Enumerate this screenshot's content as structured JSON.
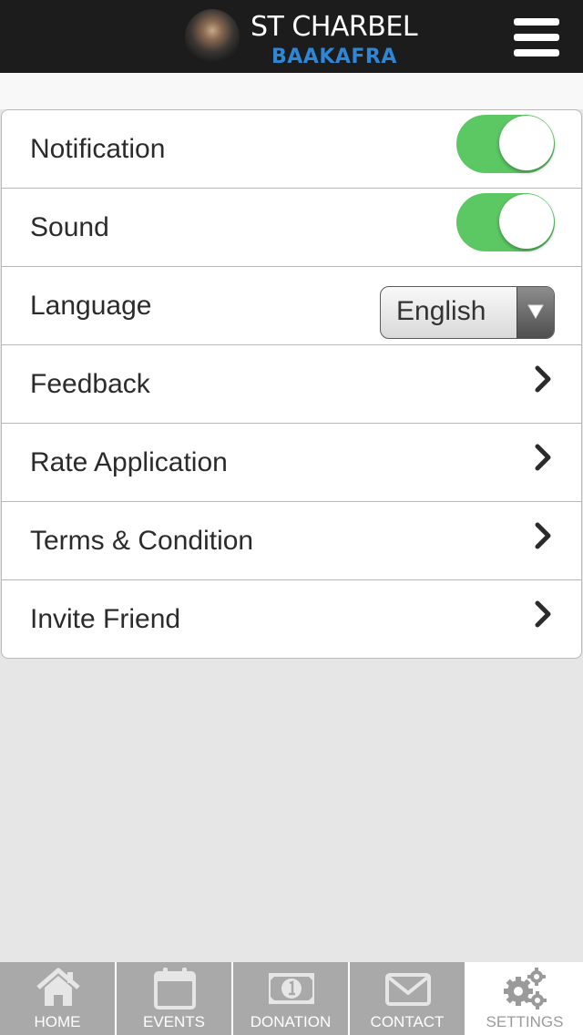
{
  "header": {
    "title": "ST CHARBEL",
    "subtitle": "BAAKAFRA",
    "menu_icon": "hamburger-icon"
  },
  "settings": {
    "notification": {
      "label": "Notification",
      "enabled": true
    },
    "sound": {
      "label": "Sound",
      "enabled": true
    },
    "language": {
      "label": "Language",
      "value": "English"
    },
    "feedback": {
      "label": "Feedback"
    },
    "rate": {
      "label": "Rate Application"
    },
    "terms": {
      "label": "Terms & Condition"
    },
    "invite": {
      "label": "Invite Friend"
    }
  },
  "tabs": [
    {
      "label": "HOME",
      "icon": "home-icon",
      "active": false
    },
    {
      "label": "EVENTS",
      "icon": "calendar-icon",
      "active": false
    },
    {
      "label": "DONATION",
      "icon": "money-icon",
      "active": false
    },
    {
      "label": "CONTACT",
      "icon": "envelope-icon",
      "active": false
    },
    {
      "label": "SETTINGS",
      "icon": "gears-icon",
      "active": true
    }
  ],
  "colors": {
    "header_bg": "#1c1c1c",
    "brand_blue": "#2e86d6",
    "toggle_on": "#5cc864",
    "tab_bg": "#a9a9a9",
    "tab_active_bg": "#ffffff"
  }
}
